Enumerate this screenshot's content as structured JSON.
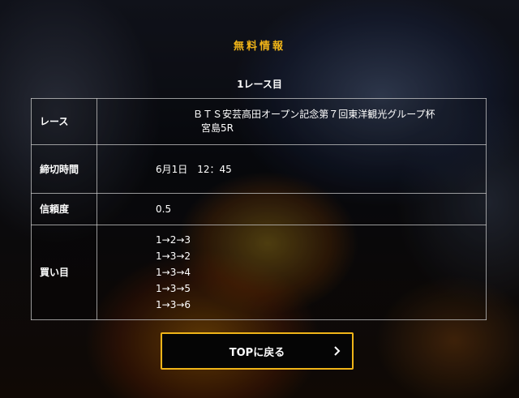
{
  "section": {
    "title": "無料情報"
  },
  "race": {
    "heading": "1レース目",
    "rows": {
      "race": {
        "label": "レース",
        "name": "ＢＴＳ安芸高田オープン記念第７回東洋観光グループ杯",
        "venue": "宮島5R"
      },
      "deadline": {
        "label": "締切時間",
        "value": "6月1日　12：45"
      },
      "reliability": {
        "label": "信頼度",
        "value": "0.5"
      },
      "bets": {
        "label": "買い目",
        "items": [
          "1→2→3",
          "1→3→2",
          "1→3→4",
          "1→3→5",
          "1→3→6"
        ]
      }
    }
  },
  "nav": {
    "top_button_label": "TOPに戻る",
    "chevron_icon": "chevron-right-icon"
  },
  "colors": {
    "accent": "#f0b418",
    "background": "#07070c",
    "text": "#ffffff",
    "border": "#c8c8c8"
  }
}
